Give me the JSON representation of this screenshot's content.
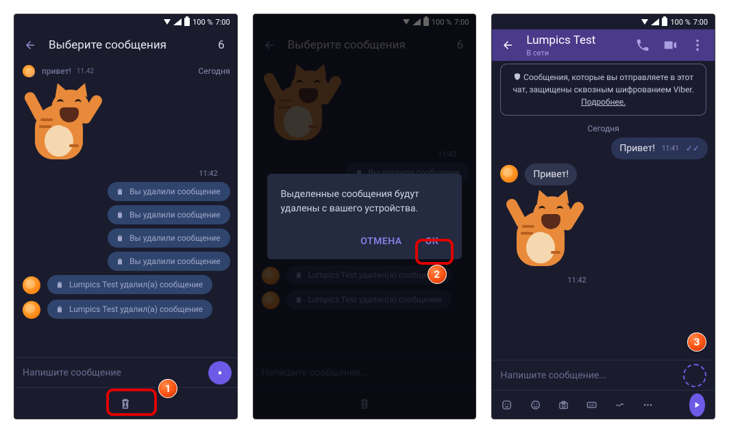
{
  "status": {
    "battery": "100 %",
    "time": "7:00"
  },
  "s1": {
    "title": "Выберите сообщения",
    "count": "6",
    "top_greeting": "привет!",
    "top_time": "11.42",
    "today": "Сегодня",
    "sticker_time": "11:42",
    "del_self": "Вы удалили сообщение",
    "del_other": "Lumpics Test удалил(а) сообщение",
    "input_placeholder": "Напишите сообщение",
    "badge": "1"
  },
  "s2": {
    "title": "Выберите сообщения",
    "count": "6",
    "sticker_time": "11:42",
    "del_self": "Вы удалили сообщение",
    "del_other": "Lumpics Test удалил(а) сообщение",
    "input_placeholder": "Напишите сообщение...",
    "dialog_text": "Выделенные сообщения будут удалены с вашего устройства.",
    "cancel": "ОТМЕНА",
    "ok": "ОК",
    "badge": "2"
  },
  "s3": {
    "contact": "Lumpics Test",
    "presence": "В сети",
    "enc_text": "Сообщения, которые вы отправляете в этот чат, защищены сквозным шифрованием Viber.",
    "enc_more": "Подробнее.",
    "today": "Сегодня",
    "sent": "Привет!",
    "sent_time": "11:41",
    "recv": "Привет!",
    "sticker_time": "11:42",
    "input_placeholder": "Напишите сообщение...",
    "badge": "3"
  }
}
